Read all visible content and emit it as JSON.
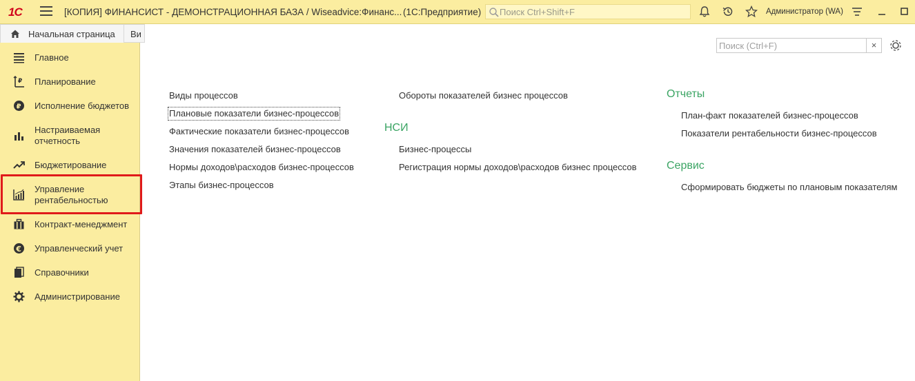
{
  "titlebar": {
    "logo_text": "1С",
    "title": "[КОПИЯ] ФИНАНСИСТ - ДЕМОНСТРАЦИОННАЯ БАЗА / Wiseadvice:Финанс...",
    "platform": "(1С:Предприятие)",
    "search_placeholder": "Поиск Ctrl+Shift+F",
    "user": "Администратор (WA)",
    "icons": [
      "bell-icon",
      "history-icon",
      "star-icon",
      "menu-lines-icon",
      "minimize-icon",
      "maximize-icon"
    ]
  },
  "tabs": {
    "home_label": "Начальная страница",
    "second_label": "Ви"
  },
  "sidebar": {
    "items": [
      {
        "label": "Главное",
        "icon": "list-icon"
      },
      {
        "label": "Планирование",
        "icon": "planning-icon"
      },
      {
        "label": "Исполнение бюджетов",
        "icon": "ruble-coin-icon"
      },
      {
        "label": "Настраиваемая отчетность",
        "icon": "bar-chart-icon"
      },
      {
        "label": "Бюджетирование",
        "icon": "trend-up-icon"
      },
      {
        "label": "Управление рентабельностью",
        "icon": "growth-chart-icon"
      },
      {
        "label": "Контракт-менеджмент",
        "icon": "briefcase-icon"
      },
      {
        "label": "Управленческий учет",
        "icon": "euro-coin-icon"
      },
      {
        "label": "Справочники",
        "icon": "books-icon"
      },
      {
        "label": "Администрирование",
        "icon": "gear-icon"
      }
    ],
    "highlight_color": "#e01a1a"
  },
  "main": {
    "search_placeholder": "Поиск (Ctrl+F)",
    "clear_label": "×",
    "col1": [
      "Виды процессов",
      "Плановые показатели бизнес-процессов",
      "Фактические показатели бизнес-процессов",
      "Значения показателей бизнес-процессов",
      "Нормы доходов\\расходов бизнес-процессов",
      "Этапы бизнес-процессов"
    ],
    "col2_top": "Обороты показателей бизнес процессов",
    "nsi_title": "НСИ",
    "nsi_items": [
      "Бизнес-процессы",
      "Регистрация нормы доходов\\расходов бизнес процессов"
    ],
    "reports_title": "Отчеты",
    "reports_items": [
      "План-факт показателей бизнес-процессов",
      "Показатели рентабельности бизнес-процессов"
    ],
    "service_title": "Сервис",
    "service_items": [
      "Сформировать бюджеты по плановым показателям"
    ],
    "group_title_color": "#3aa463"
  }
}
